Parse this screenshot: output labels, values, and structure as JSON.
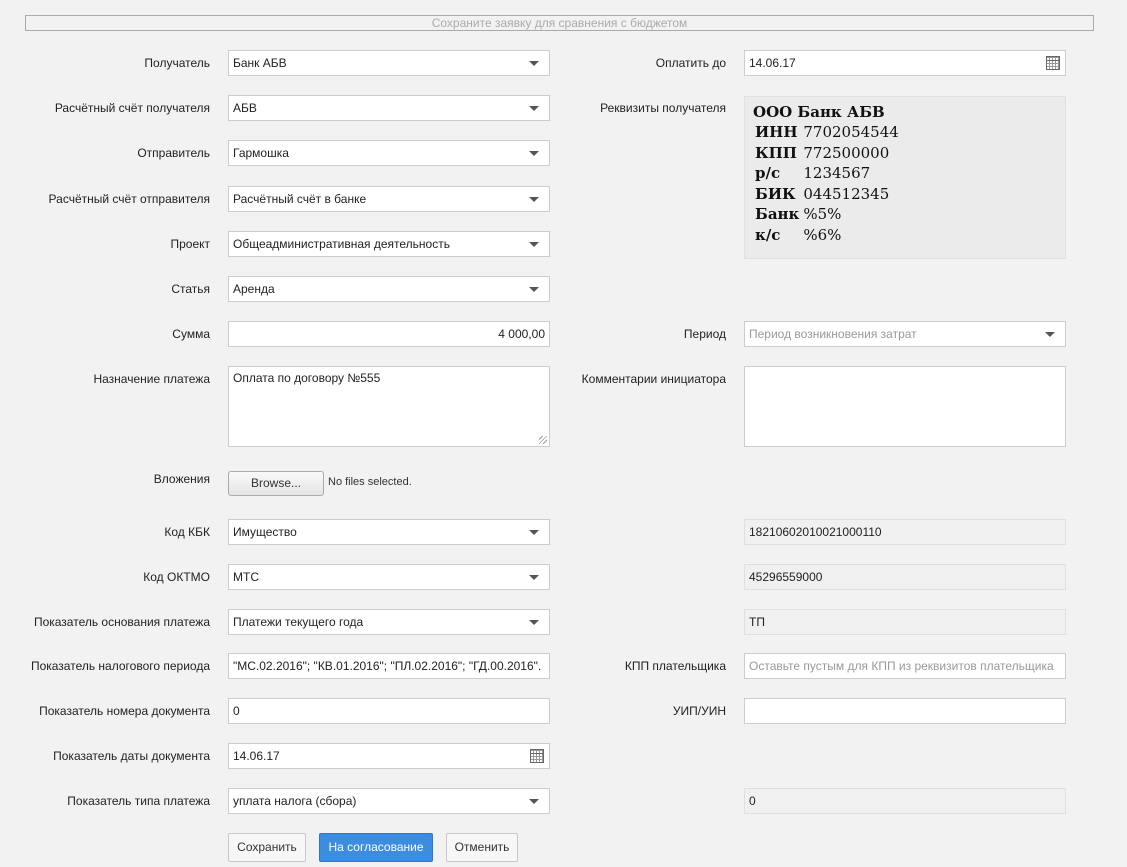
{
  "budget_bar": "Сохраните заявку для сравнения с бюджетом",
  "recipient": {
    "label": "Получатель",
    "value": "Банк АБВ"
  },
  "pay_until": {
    "label": "Оплатить до",
    "value": "14.06.17"
  },
  "recipient_account": {
    "label": "Расчётный счёт получателя",
    "value": "АБВ"
  },
  "requisites": {
    "label": "Реквизиты получателя",
    "title": "ООО Банк АБВ",
    "rows": [
      {
        "k": "ИНН",
        "v": "7702054544"
      },
      {
        "k": "КПП",
        "v": "772500000"
      },
      {
        "k": "р/с",
        "v": "1234567"
      },
      {
        "k": "БИК",
        "v": "044512345"
      },
      {
        "k": "Банк",
        "v": "%5%"
      },
      {
        "k": "к/с",
        "v": "%6%"
      }
    ]
  },
  "sender": {
    "label": "Отправитель",
    "value": "Гармошка"
  },
  "sender_account": {
    "label": "Расчётный счёт отправителя",
    "value": "Расчётный счёт в банке"
  },
  "project": {
    "label": "Проект",
    "value": "Общеадминистративная деятельность"
  },
  "article": {
    "label": "Статья",
    "value": "Аренда"
  },
  "amount": {
    "label": "Сумма",
    "value": "4 000,00"
  },
  "period": {
    "label": "Период",
    "placeholder": "Период возникновения затрат"
  },
  "purpose": {
    "label": "Назначение платежа",
    "value": "Оплата по договору №555"
  },
  "initiator_comments": {
    "label": "Комментарии инициатора",
    "value": ""
  },
  "attachments": {
    "label": "Вложения",
    "browse": "Browse...",
    "status": "No files selected."
  },
  "kbk": {
    "label": "Код КБК",
    "value": "Имущество",
    "code": "18210602010021000110"
  },
  "oktmo": {
    "label": "Код ОКТМО",
    "value": "МТС",
    "code": "45296559000"
  },
  "basis": {
    "label": "Показатель основания платежа",
    "value": "Платежи текущего года",
    "code": "ТП"
  },
  "tax_period": {
    "label": "Показатель налогового периода",
    "value": "\"МС.02.2016\"; \"КВ.01.2016\"; \"ПЛ.02.2016\"; \"ГД.00.2016\"."
  },
  "payer_kpp": {
    "label": "КПП плательщика",
    "placeholder": "Оставьте пустым для КПП из реквизитов плательщика"
  },
  "doc_number": {
    "label": "Показатель номера документа",
    "value": "0"
  },
  "uip": {
    "label": "УИП/УИН",
    "value": ""
  },
  "doc_date": {
    "label": "Показатель даты документа",
    "value": "14.06.17"
  },
  "payment_type": {
    "label": "Показатель типа платежа",
    "value": "уплата налога (сбора)",
    "code": "0"
  },
  "buttons": {
    "save": "Сохранить",
    "approve": "На согласование",
    "cancel": "Отменить"
  },
  "colors": {
    "primary_button": "#3b8de0",
    "background": "#f2f2f2"
  }
}
